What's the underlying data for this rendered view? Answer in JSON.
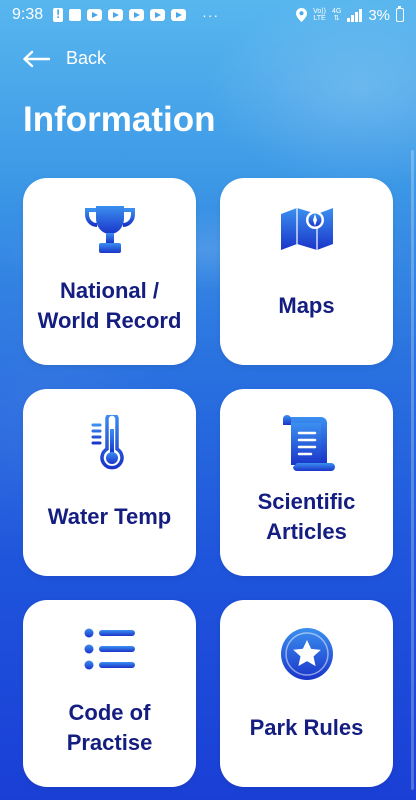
{
  "status_bar": {
    "time": "9:38",
    "dots": "···",
    "network_top": "Vo))",
    "network_bottom": "LTE",
    "net_type": "4G",
    "battery": "3%"
  },
  "header": {
    "back_label": "Back",
    "title": "Information"
  },
  "cards": [
    {
      "label": "National / World Record",
      "icon": "trophy-icon"
    },
    {
      "label": "Maps",
      "icon": "map-icon"
    },
    {
      "label": "Water Temp",
      "icon": "thermometer-icon"
    },
    {
      "label": "Scientific Articles",
      "icon": "scroll-icon"
    },
    {
      "label": "Code of Practise",
      "icon": "list-icon"
    },
    {
      "label": "Park Rules",
      "icon": "star-badge-icon"
    }
  ],
  "colors": {
    "card_text": "#141d80",
    "icon_top": "#3b8ff0",
    "icon_bottom": "#1a35c9"
  }
}
